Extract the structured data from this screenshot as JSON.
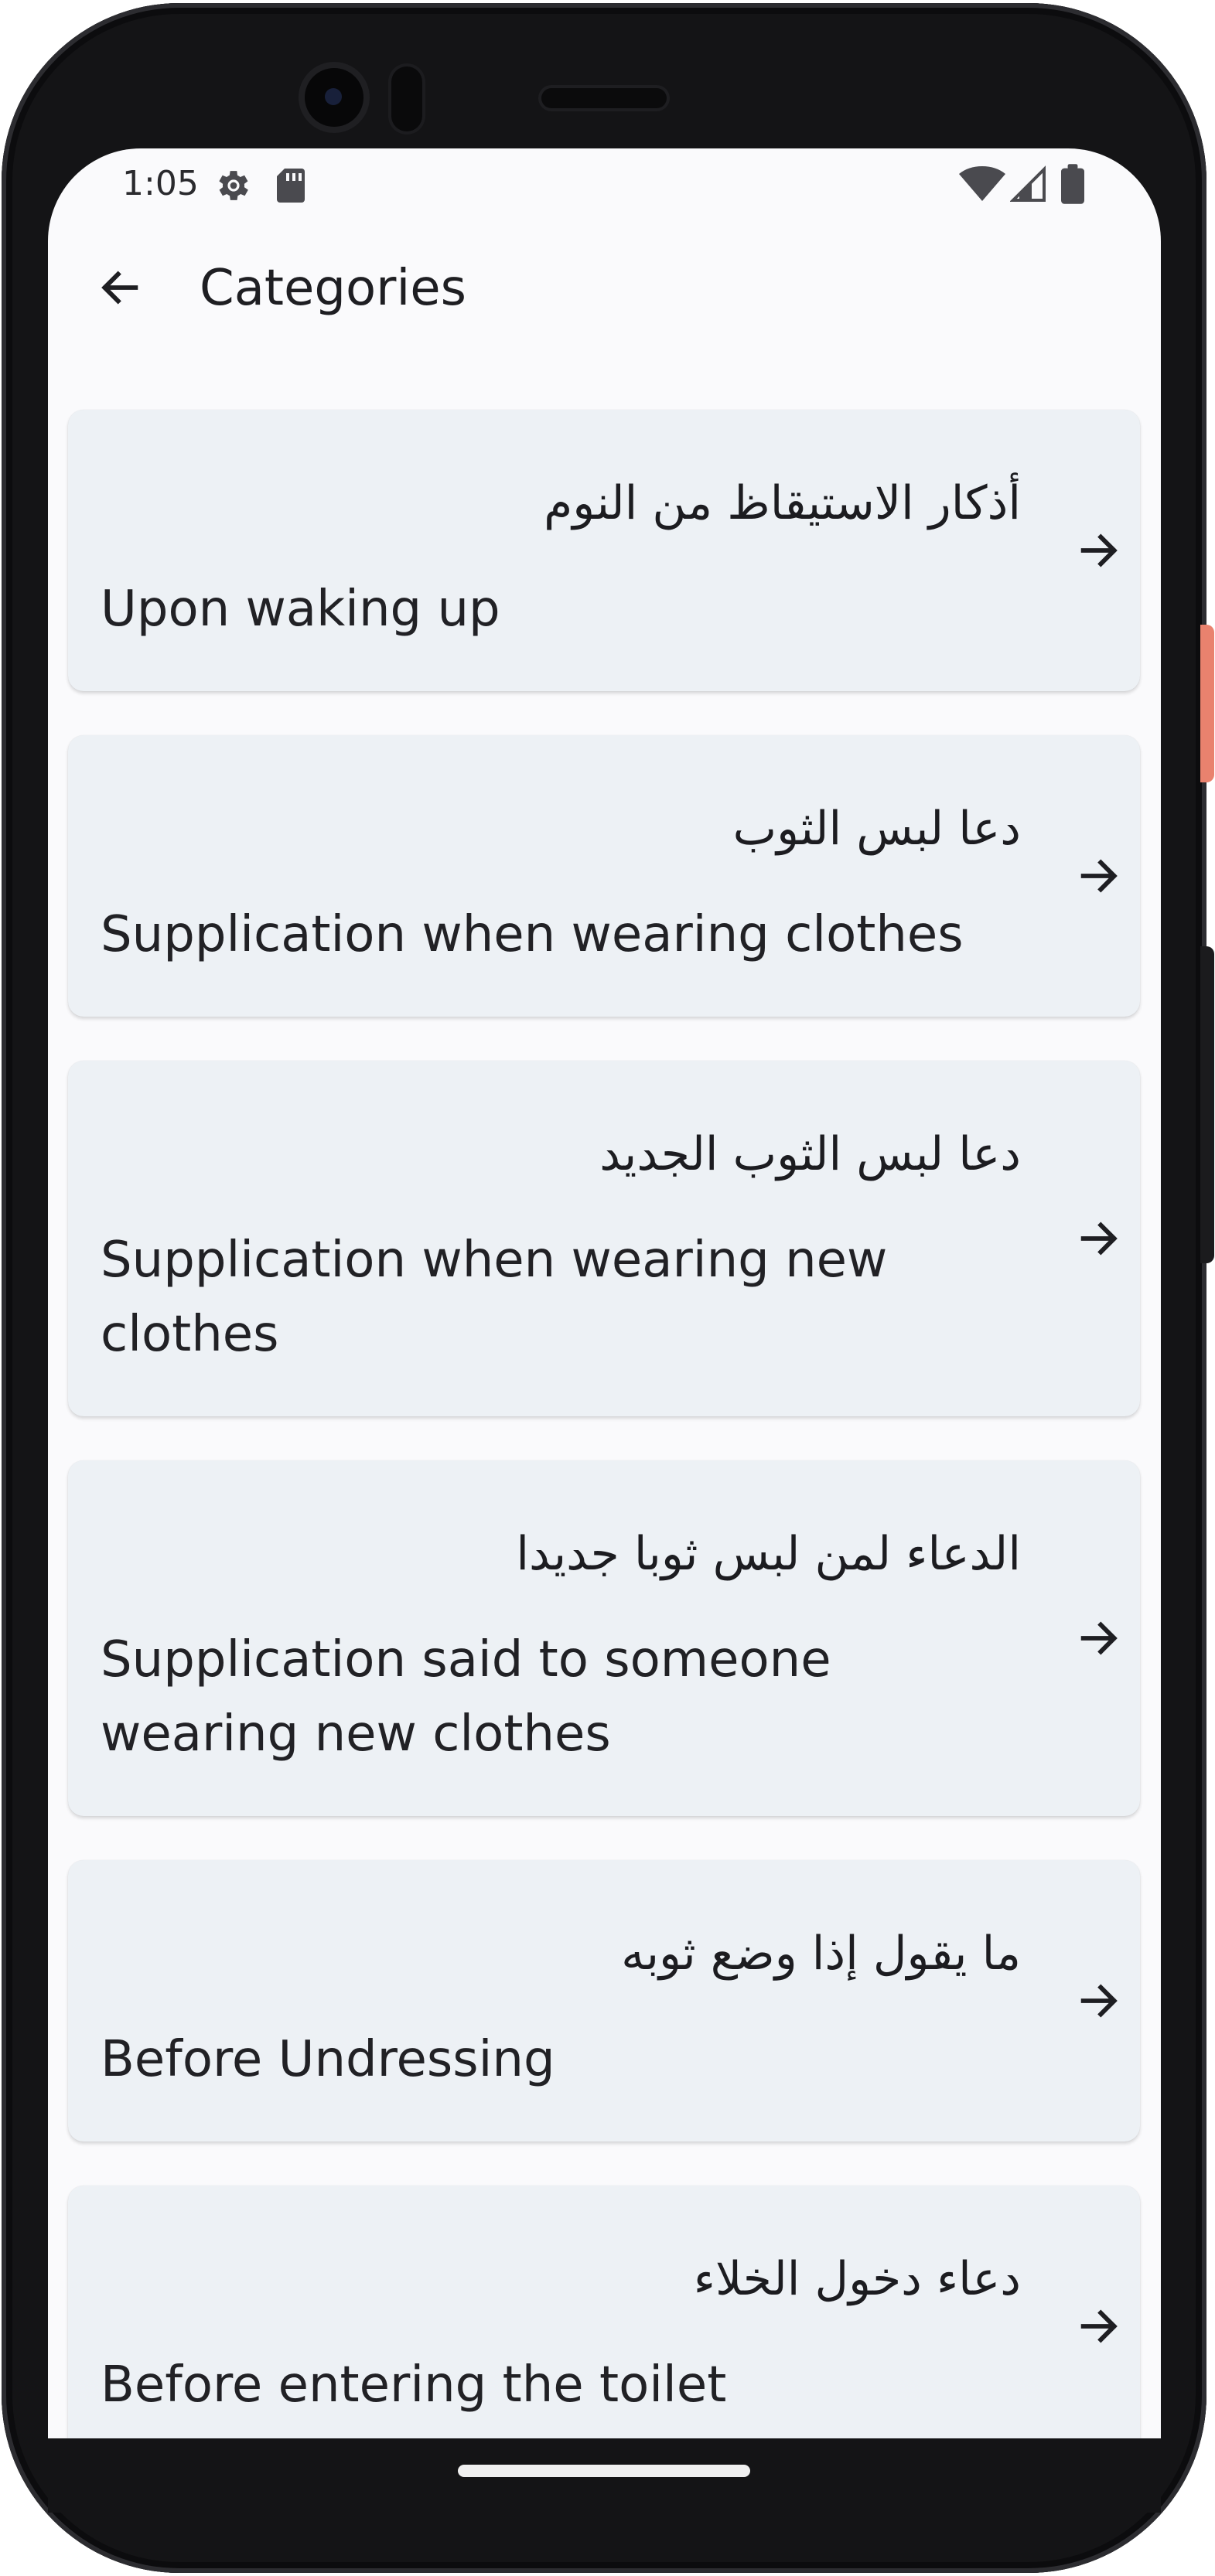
{
  "status_bar": {
    "time": "1:05",
    "icons": [
      "gear-icon",
      "sd-card-icon",
      "wifi-icon",
      "signal-icon",
      "battery-icon"
    ]
  },
  "app_bar": {
    "title": "Categories",
    "back_icon": "arrow-left-icon"
  },
  "categories": [
    {
      "arabic": "أذكار الاستيقاظ من النوم",
      "english": "Upon waking up",
      "arrow_icon": "arrow-right-icon"
    },
    {
      "arabic": "دعا لبس الثوب",
      "english": "Supplication when wearing clothes",
      "arrow_icon": "arrow-right-icon"
    },
    {
      "arabic": "دعا لبس الثوب الجديد",
      "english": "Supplication when wearing new clothes",
      "arrow_icon": "arrow-right-icon"
    },
    {
      "arabic": "الدعاء لمن لبس ثوبا جديدا",
      "english": "Supplication said to someone wearing new clothes",
      "arrow_icon": "arrow-right-icon"
    },
    {
      "arabic": "ما يقول إذا وضع ثوبه",
      "english": "Before Undressing",
      "arrow_icon": "arrow-right-icon"
    },
    {
      "arabic": "دعاء دخول الخلاء",
      "english": "Before entering the toilet",
      "arrow_icon": "arrow-right-icon"
    }
  ],
  "colors": {
    "screen_background": "#fafafc",
    "card_background": "#edf1f5",
    "text": "#212125",
    "accent_button": "#e9826e"
  }
}
